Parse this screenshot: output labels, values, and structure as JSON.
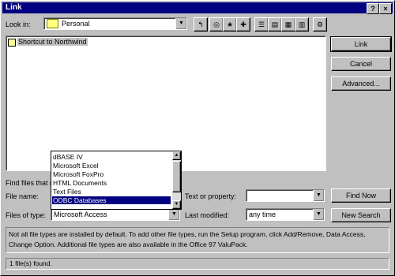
{
  "window": {
    "title": "Link",
    "help_glyph": "?",
    "close_glyph": "×"
  },
  "look_in": {
    "label": "Look in:",
    "value": "Personal"
  },
  "toolbar": {
    "up_glyph": "↰",
    "web_glyph": "◎",
    "favorites_glyph": "★",
    "add_fav_glyph": "✚",
    "list_glyph": "☰",
    "details_glyph": "▤",
    "properties_glyph": "▦",
    "preview_glyph": "▥",
    "commands_glyph": "⚙"
  },
  "file_list": {
    "items": [
      {
        "name": "Shortcut to Northwind"
      }
    ]
  },
  "buttons": {
    "link": "Link",
    "cancel": "Cancel",
    "advanced": "Advanced...",
    "find_now": "Find Now",
    "new_search": "New Search"
  },
  "search": {
    "find_files_label": "Find files that match these search criteria:",
    "file_name_label": "File name:",
    "file_name_value": "",
    "file_type_label": "Files of type:",
    "file_type_value": "Microsoft Access",
    "text_property_label": "Text or property:",
    "text_property_value": "",
    "last_modified_label": "Last modified:",
    "last_modified_value": "any time"
  },
  "file_type_dropdown": {
    "options": [
      "dBASE IV",
      "Microsoft Excel",
      "Microsoft FoxPro",
      "HTML Documents",
      "Text Files",
      "ODBC Databases"
    ],
    "selected_index": 5
  },
  "info_text": "Not all file types are installed by default.  To add other file types, run the Setup program, click Add/Remove, Data Access, Change Option.  Additional file types are also available in the Office 97 ValuPack.",
  "status": "1 file(s) found."
}
